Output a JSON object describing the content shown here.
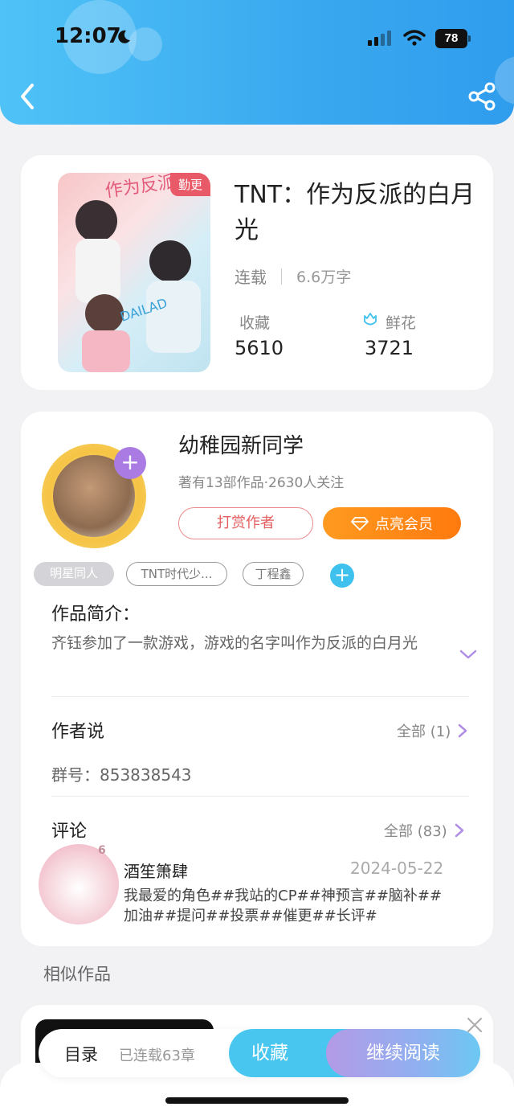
{
  "status_bar": {
    "time": "12:07",
    "battery": "78"
  },
  "book": {
    "title": "TNT：作为反派的白月光",
    "badge": "勤更",
    "status": "连载",
    "word_count": "6.6万字",
    "favorites_label": "收藏",
    "favorites_value": "5610",
    "flowers_label": "鲜花",
    "flowers_value": "3721"
  },
  "author": {
    "name": "幼稚园新同学",
    "stats": "著有13部作品·2630人关注",
    "tip_label": "打赏作者",
    "vip_label": "点亮会员",
    "tags": [
      "明星同人",
      "TNT时代少...",
      "丁程鑫"
    ]
  },
  "intro": {
    "title": "作品简介：",
    "text": "齐钰参加了一款游戏，游戏的名字叫作为反派的白月光"
  },
  "author_says": {
    "title": "作者说",
    "all_label": "全部 (1)",
    "content": "群号：853838543"
  },
  "comments": {
    "title": "评论",
    "all_label": "全部 (83)",
    "items": [
      {
        "user": "酒笙箫肆",
        "level": "6",
        "date": "2024-05-22",
        "text": "我最爱的角色##我站的CP##神预言##脑补##加油##提问##投票##催更##长评#"
      }
    ]
  },
  "similar": {
    "title": "相似作品"
  },
  "bottom_bar": {
    "toc_label": "目录",
    "chapter_count": "已连载63章",
    "favorite_label": "收藏",
    "read_label": "继续阅读"
  },
  "colors": {
    "header_blue": "#3aa8ef",
    "accent_cyan": "#49c6ef",
    "vip_orange": "#ff8a14",
    "tip_red": "#e45f5f",
    "purple": "#a97be3"
  }
}
